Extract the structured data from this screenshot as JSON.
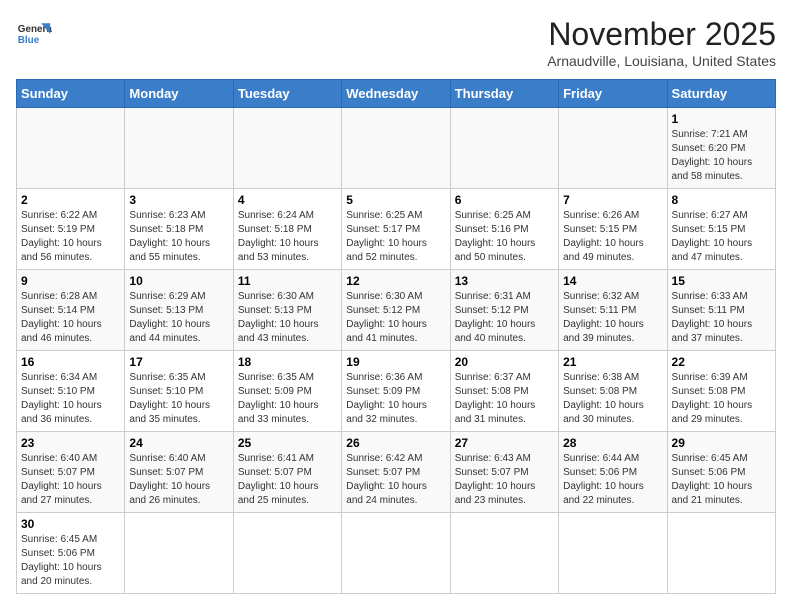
{
  "header": {
    "logo_general": "General",
    "logo_blue": "Blue",
    "month_year": "November 2025",
    "location": "Arnaudville, Louisiana, United States"
  },
  "days_of_week": [
    "Sunday",
    "Monday",
    "Tuesday",
    "Wednesday",
    "Thursday",
    "Friday",
    "Saturday"
  ],
  "weeks": [
    [
      {
        "day": "",
        "info": ""
      },
      {
        "day": "",
        "info": ""
      },
      {
        "day": "",
        "info": ""
      },
      {
        "day": "",
        "info": ""
      },
      {
        "day": "",
        "info": ""
      },
      {
        "day": "",
        "info": ""
      },
      {
        "day": "1",
        "info": "Sunrise: 7:21 AM\nSunset: 6:20 PM\nDaylight: 10 hours and 58 minutes."
      }
    ],
    [
      {
        "day": "2",
        "info": "Sunrise: 6:22 AM\nSunset: 5:19 PM\nDaylight: 10 hours and 56 minutes."
      },
      {
        "day": "3",
        "info": "Sunrise: 6:23 AM\nSunset: 5:18 PM\nDaylight: 10 hours and 55 minutes."
      },
      {
        "day": "4",
        "info": "Sunrise: 6:24 AM\nSunset: 5:18 PM\nDaylight: 10 hours and 53 minutes."
      },
      {
        "day": "5",
        "info": "Sunrise: 6:25 AM\nSunset: 5:17 PM\nDaylight: 10 hours and 52 minutes."
      },
      {
        "day": "6",
        "info": "Sunrise: 6:25 AM\nSunset: 5:16 PM\nDaylight: 10 hours and 50 minutes."
      },
      {
        "day": "7",
        "info": "Sunrise: 6:26 AM\nSunset: 5:15 PM\nDaylight: 10 hours and 49 minutes."
      },
      {
        "day": "8",
        "info": "Sunrise: 6:27 AM\nSunset: 5:15 PM\nDaylight: 10 hours and 47 minutes."
      }
    ],
    [
      {
        "day": "9",
        "info": "Sunrise: 6:28 AM\nSunset: 5:14 PM\nDaylight: 10 hours and 46 minutes."
      },
      {
        "day": "10",
        "info": "Sunrise: 6:29 AM\nSunset: 5:13 PM\nDaylight: 10 hours and 44 minutes."
      },
      {
        "day": "11",
        "info": "Sunrise: 6:30 AM\nSunset: 5:13 PM\nDaylight: 10 hours and 43 minutes."
      },
      {
        "day": "12",
        "info": "Sunrise: 6:30 AM\nSunset: 5:12 PM\nDaylight: 10 hours and 41 minutes."
      },
      {
        "day": "13",
        "info": "Sunrise: 6:31 AM\nSunset: 5:12 PM\nDaylight: 10 hours and 40 minutes."
      },
      {
        "day": "14",
        "info": "Sunrise: 6:32 AM\nSunset: 5:11 PM\nDaylight: 10 hours and 39 minutes."
      },
      {
        "day": "15",
        "info": "Sunrise: 6:33 AM\nSunset: 5:11 PM\nDaylight: 10 hours and 37 minutes."
      }
    ],
    [
      {
        "day": "16",
        "info": "Sunrise: 6:34 AM\nSunset: 5:10 PM\nDaylight: 10 hours and 36 minutes."
      },
      {
        "day": "17",
        "info": "Sunrise: 6:35 AM\nSunset: 5:10 PM\nDaylight: 10 hours and 35 minutes."
      },
      {
        "day": "18",
        "info": "Sunrise: 6:35 AM\nSunset: 5:09 PM\nDaylight: 10 hours and 33 minutes."
      },
      {
        "day": "19",
        "info": "Sunrise: 6:36 AM\nSunset: 5:09 PM\nDaylight: 10 hours and 32 minutes."
      },
      {
        "day": "20",
        "info": "Sunrise: 6:37 AM\nSunset: 5:08 PM\nDaylight: 10 hours and 31 minutes."
      },
      {
        "day": "21",
        "info": "Sunrise: 6:38 AM\nSunset: 5:08 PM\nDaylight: 10 hours and 30 minutes."
      },
      {
        "day": "22",
        "info": "Sunrise: 6:39 AM\nSunset: 5:08 PM\nDaylight: 10 hours and 29 minutes."
      }
    ],
    [
      {
        "day": "23",
        "info": "Sunrise: 6:40 AM\nSunset: 5:07 PM\nDaylight: 10 hours and 27 minutes."
      },
      {
        "day": "24",
        "info": "Sunrise: 6:40 AM\nSunset: 5:07 PM\nDaylight: 10 hours and 26 minutes."
      },
      {
        "day": "25",
        "info": "Sunrise: 6:41 AM\nSunset: 5:07 PM\nDaylight: 10 hours and 25 minutes."
      },
      {
        "day": "26",
        "info": "Sunrise: 6:42 AM\nSunset: 5:07 PM\nDaylight: 10 hours and 24 minutes."
      },
      {
        "day": "27",
        "info": "Sunrise: 6:43 AM\nSunset: 5:07 PM\nDaylight: 10 hours and 23 minutes."
      },
      {
        "day": "28",
        "info": "Sunrise: 6:44 AM\nSunset: 5:06 PM\nDaylight: 10 hours and 22 minutes."
      },
      {
        "day": "29",
        "info": "Sunrise: 6:45 AM\nSunset: 5:06 PM\nDaylight: 10 hours and 21 minutes."
      }
    ],
    [
      {
        "day": "30",
        "info": "Sunrise: 6:45 AM\nSunset: 5:06 PM\nDaylight: 10 hours and 20 minutes."
      },
      {
        "day": "",
        "info": ""
      },
      {
        "day": "",
        "info": ""
      },
      {
        "day": "",
        "info": ""
      },
      {
        "day": "",
        "info": ""
      },
      {
        "day": "",
        "info": ""
      },
      {
        "day": "",
        "info": ""
      }
    ]
  ]
}
